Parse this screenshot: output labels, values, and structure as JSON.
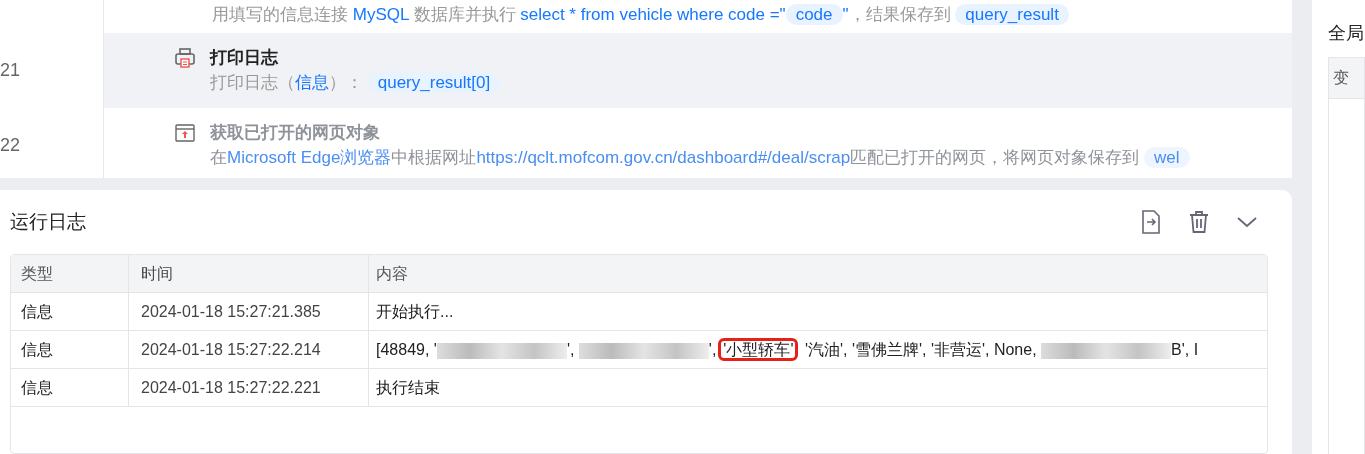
{
  "flow": {
    "rows": [
      {
        "number": "",
        "title": "",
        "kind": "query",
        "selected": false,
        "disabled": false,
        "description": [
          {
            "kind": "text",
            "text": "用填写的信息连接 "
          },
          {
            "kind": "link",
            "text": "MySQL"
          },
          {
            "kind": "text",
            "text": " 数据库并执行 "
          },
          {
            "kind": "link",
            "text": "select * from vehicle where code =\""
          },
          {
            "kind": "chip",
            "text": "code"
          },
          {
            "kind": "link",
            "text": "\""
          },
          {
            "kind": "text",
            "text": "，结果保存到 "
          },
          {
            "kind": "chip",
            "text": "query_result"
          }
        ]
      },
      {
        "number": "21",
        "title": "打印日志",
        "kind": "print",
        "selected": true,
        "disabled": false,
        "description": [
          {
            "kind": "text",
            "text": "打印日志（"
          },
          {
            "kind": "link",
            "text": "信息"
          },
          {
            "kind": "text",
            "text": "）： "
          },
          {
            "kind": "chip",
            "text": "query_result[0]"
          }
        ]
      },
      {
        "number": "22",
        "title": "获取已打开的网页对象",
        "kind": "browser",
        "selected": false,
        "disabled": true,
        "description": [
          {
            "kind": "text",
            "text": "在"
          },
          {
            "kind": "link",
            "text": "Microsoft Edge浏览器"
          },
          {
            "kind": "text",
            "text": "中根据网址"
          },
          {
            "kind": "link",
            "text": "https://qclt.mofcom.gov.cn/dashboard#/deal/scrap"
          },
          {
            "kind": "text",
            "text": "匹配已打开的网页，将网页对象保存到 "
          },
          {
            "kind": "chip",
            "text": "wel"
          }
        ]
      }
    ]
  },
  "log": {
    "title": "运行日志",
    "columns": [
      "类型",
      "时间",
      "内容"
    ],
    "rows": [
      {
        "type": "信息",
        "time": "2024-01-18 15:27:21.385",
        "content": [
          {
            "kind": "text",
            "text": "开始执行..."
          }
        ]
      },
      {
        "type": "信息",
        "time": "2024-01-18 15:27:22.214",
        "content": [
          {
            "kind": "text",
            "text": "[48849, '"
          },
          {
            "kind": "redacted"
          },
          {
            "kind": "text",
            "text": "', "
          },
          {
            "kind": "redacted"
          },
          {
            "kind": "text",
            "text": "',"
          },
          {
            "kind": "highlight",
            "text": "'小型轿车'"
          },
          {
            "kind": "text",
            "text": " '汽油', '雪佛兰牌', '非营运', None, "
          },
          {
            "kind": "redacted"
          },
          {
            "kind": "text",
            "text": "B', I"
          }
        ]
      },
      {
        "type": "信息",
        "time": "2024-01-18 15:27:22.221",
        "content": [
          {
            "kind": "text",
            "text": "执行结束"
          }
        ]
      }
    ]
  },
  "side_panel": {
    "title": "全局",
    "column": "变"
  }
}
